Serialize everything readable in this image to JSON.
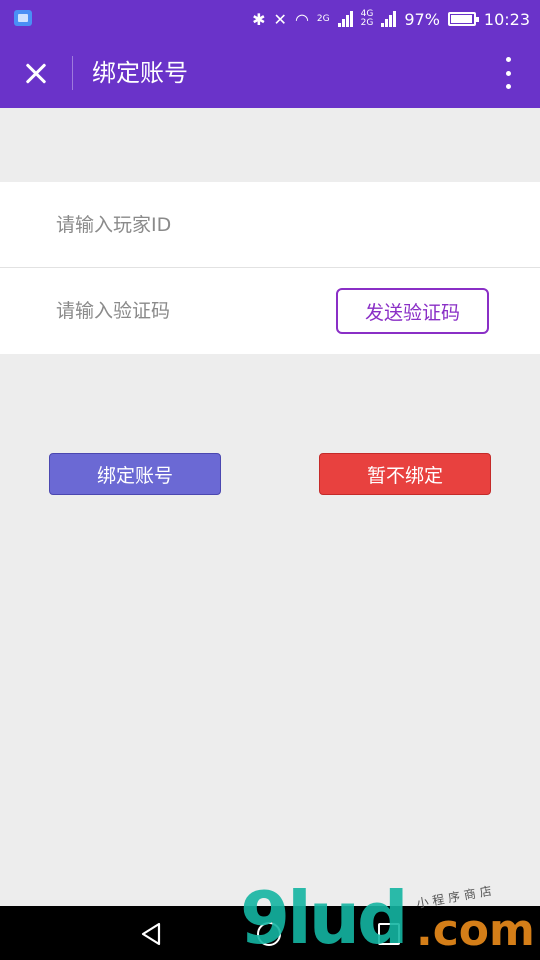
{
  "status_bar": {
    "battery": "97%",
    "time": "10:23",
    "network_top": "4G",
    "network_bottom": "2G",
    "sim2_label": "2G",
    "icons": [
      "gallery-notification-icon",
      "bluetooth-icon",
      "vibrate-off-icon",
      "wifi-icon",
      "signal-icon",
      "battery-icon"
    ]
  },
  "app_bar": {
    "title": "绑定账号",
    "close_icon": "close-icon",
    "more_icon": "more-vert-icon"
  },
  "form": {
    "player_id_placeholder": "请输入玩家ID",
    "player_id_value": "",
    "code_placeholder": "请输入验证码",
    "code_value": "",
    "send_code_label": "发送验证码"
  },
  "actions": {
    "bind_label": "绑定账号",
    "skip_label": "暂不绑定"
  },
  "colors": {
    "accent": "#6a33c9",
    "send_code": "#8a2fc6",
    "bind_button": "#6b69d4",
    "skip_button": "#e8413f",
    "background": "#ededed"
  },
  "watermark": {
    "brand": "9lud",
    "suffix": ".com",
    "tagline": "小程序商店"
  }
}
